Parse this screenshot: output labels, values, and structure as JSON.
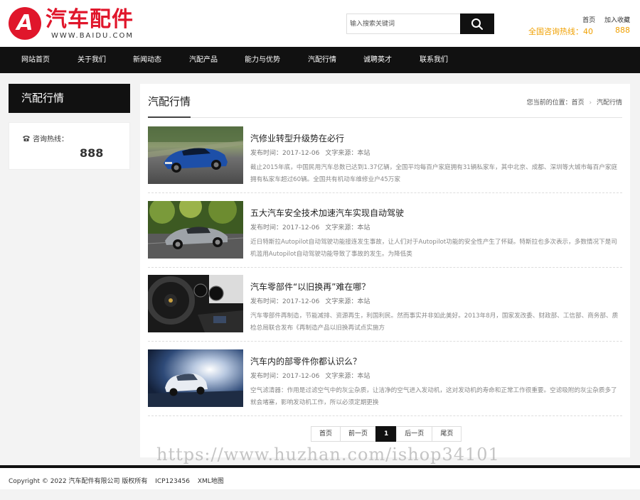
{
  "brand": {
    "name": "汽车配件",
    "domain": "WWW.BAIDU.COM",
    "logo_letter": "A",
    "color": "#e0162b"
  },
  "search": {
    "placeholder": "输入搜索关键词",
    "button_icon": "search-icon"
  },
  "toplinks": {
    "home": "首页",
    "favorite": "加入收藏"
  },
  "hotline": {
    "label": "全国咨询热线：40",
    "number": "888",
    "color": "#f0a000"
  },
  "nav": {
    "items": [
      {
        "label": "网站首页"
      },
      {
        "label": "关于我们"
      },
      {
        "label": "新闻动态"
      },
      {
        "label": "汽配产品"
      },
      {
        "label": "能力与优势"
      },
      {
        "label": "汽配行情"
      },
      {
        "label": "诚聘英才"
      },
      {
        "label": "联系我们"
      }
    ]
  },
  "sidebar": {
    "title": "汽配行情",
    "hotline_label": "咨询热线：",
    "hotline_number": "888"
  },
  "main": {
    "title": "汽配行情",
    "breadcrumb": {
      "prefix": "您当前的位置：",
      "home": "首页",
      "current": "汽配行情"
    }
  },
  "articles": [
    {
      "title": "汽修业转型升级势在必行",
      "date": "发布时间：2017-12-06",
      "source": "文字来源：本站",
      "desc": "截止2015年底，中国民用汽车总数已达到1.37亿辆，全国平均每百户家庭拥有31辆私家车，其中北京、成都、深圳等大城市每百户家庭拥有私家车超过60辆。全国共有机动车维修业户45万家"
    },
    {
      "title": "五大汽车安全技术加速汽车实现自动驾驶",
      "date": "发布时间：2017-12-06",
      "source": "文字来源：本站",
      "desc": "近日特斯拉Autopilot自动驾驶功能接连发生事故，让人们对于Autopilot功能的安全性产生了怀疑。特斯拉也多次表示，多数情况下是司机滥用Autopilot自动驾驶功能导致了事故的发生。为降低类"
    },
    {
      "title": "汽车零部件“以旧换再”难在哪？",
      "date": "发布时间：2017-12-06",
      "source": "文字来源：本站",
      "desc": "汽车零部件再制造，节能减排、资源再生，利国利民。然而事实并非如此美好。2013年8月，国家发改委、财政部、工信部、商务部、质检总局联合发布《再制造产品以旧换再试点实施方"
    },
    {
      "title": "汽车内的部零件你都认识么？",
      "date": "发布时间：2017-12-06",
      "source": "文字来源：本站",
      "desc": "空气滤清器：作用是过滤空气中的灰尘杂质，让洁净的空气进入发动机，这对发动机的寿命和正常工作很重要。空滤吸附的灰尘杂质多了就会堵塞，影响发动机工作，所以必须定期更换"
    }
  ],
  "pager": {
    "first": "首页",
    "prev": "前一页",
    "current": "1",
    "next": "后一页",
    "last": "尾页"
  },
  "watermark": "https://www.huzhan.com/ishop34101",
  "footer": {
    "copyright": "Copyright © 2022 汽车配件有限公司 版权所有",
    "icp": "ICP123456",
    "xml": "XML地图"
  }
}
